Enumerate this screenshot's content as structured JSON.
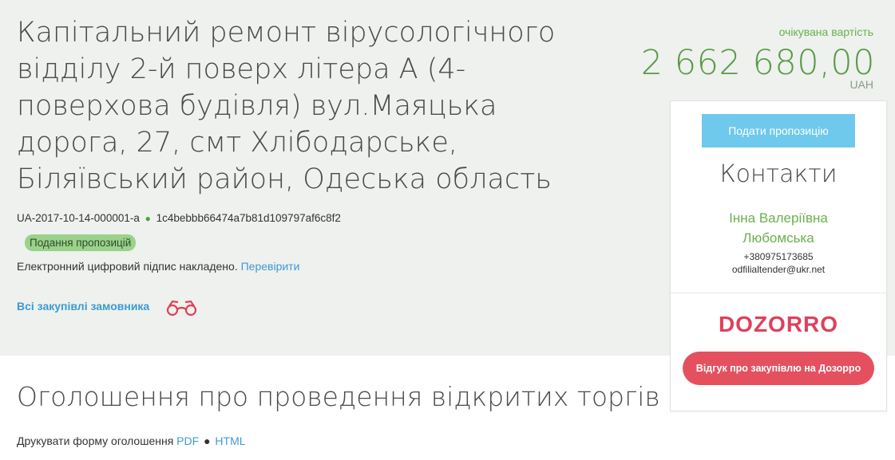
{
  "tender": {
    "title": "Капітальний ремонт вірусологічного відділу 2-й поверх літера А (4-поверхова будівля) вул.Маяцька дорога, 27, смт Хлібодарське, Біляївський район, Одеська область",
    "id": "UA-2017-10-14-000001-a",
    "hash": "1c4bebbb66474a7b81d109797af6c8f2",
    "status": "Подання пропозицій",
    "signature_text": "Електронний цифровий підпис накладено.",
    "signature_link": "Перевірити",
    "all_purchases_link": "Всі закупівлі замовника",
    "binoculars_icon": "binoculars-icon"
  },
  "price": {
    "label": "очікувана вартість",
    "amount": "2 662 680,00",
    "currency": "UAH"
  },
  "card": {
    "propose_button": "Подати пропозицію",
    "contacts_heading": "Контакти",
    "contact_name": "Інна Валеріївна Любомська",
    "contact_phone": "+380975173685",
    "contact_email": "odfilialtender@ukr.net",
    "dozorro_logo": "DOZORRO",
    "dozorro_button": "Відгук про закупівлю на Дозорро"
  },
  "announcement": {
    "heading": "Оголошення про проведення відкритих торгів",
    "print_label": "Друкувати форму оголошення",
    "pdf_link": "PDF",
    "separator": "●",
    "html_link": "HTML"
  },
  "colors": {
    "hero_bg": "#eef1ee",
    "price_green": "#5a9a47",
    "link_blue": "#3d9ad3",
    "propose_blue": "#6fc9ec",
    "dozorro_red": "#e5505f"
  }
}
